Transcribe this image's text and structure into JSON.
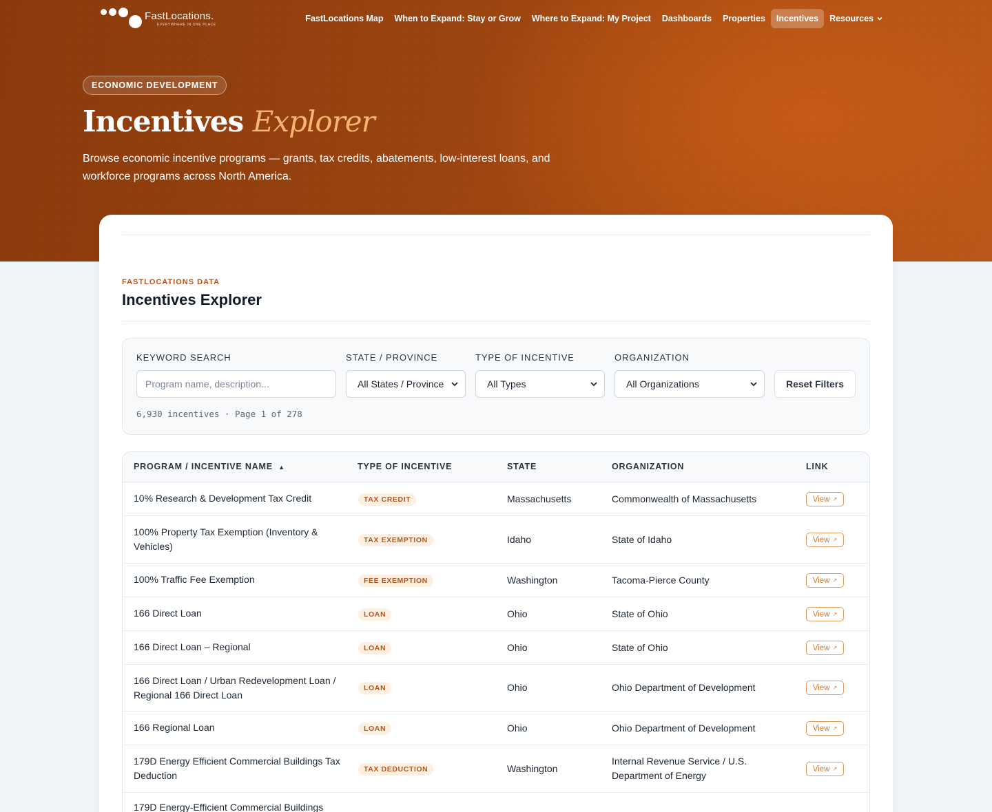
{
  "brand": {
    "name": "FastLocations.",
    "tagline": "EVERYWHERE IN ONE PLACE"
  },
  "nav": {
    "items": [
      {
        "label": "FastLocations Map",
        "active": false
      },
      {
        "label": "When to Expand: Stay or Grow",
        "active": false
      },
      {
        "label": "Where to Expand: My Project",
        "active": false
      },
      {
        "label": "Dashboards",
        "active": false
      },
      {
        "label": "Properties",
        "active": false
      },
      {
        "label": "Incentives",
        "active": true
      },
      {
        "label": "Resources",
        "active": false,
        "dropdown": true
      }
    ]
  },
  "hero": {
    "badge": "ECONOMIC DEVELOPMENT",
    "title_main": "Incentives",
    "title_accent": "Explorer",
    "description": "Browse economic incentive programs — grants, tax credits, abatements, low-interest loans, and workforce programs across North America."
  },
  "section": {
    "eyebrow": "FASTLOCATIONS DATA",
    "title": "Incentives Explorer"
  },
  "filters": {
    "keyword_label": "KEYWORD SEARCH",
    "keyword_placeholder": "Program name, description...",
    "state_label": "STATE / PROVINCE",
    "state_value": "All States / Province",
    "type_label": "TYPE OF INCENTIVE",
    "type_value": "All Types",
    "org_label": "ORGANIZATION",
    "org_value": "All Organizations",
    "reset_label": "Reset Filters",
    "summary": "6,930 incentives · Page 1 of 278"
  },
  "table": {
    "columns": [
      "PROGRAM / INCENTIVE NAME",
      "TYPE OF INCENTIVE",
      "STATE",
      "ORGANIZATION",
      "LINK"
    ],
    "sort_indicator": "▲",
    "link_label": "View",
    "rows": [
      {
        "name": "10% Research & Development Tax Credit",
        "type": "TAX CREDIT",
        "state": "Massachusetts",
        "org": "Commonwealth of Massachusetts"
      },
      {
        "name": "100% Property Tax Exemption (Inventory & Vehicles)",
        "type": "TAX EXEMPTION",
        "state": "Idaho",
        "org": "State of Idaho"
      },
      {
        "name": "100% Traffic Fee Exemption",
        "type": "FEE EXEMPTION",
        "state": "Washington",
        "org": "Tacoma-Pierce County"
      },
      {
        "name": "166 Direct Loan",
        "type": "LOAN",
        "state": "Ohio",
        "org": "State of Ohio"
      },
      {
        "name": "166 Direct Loan – Regional",
        "type": "LOAN",
        "state": "Ohio",
        "org": "State of Ohio"
      },
      {
        "name": "166 Direct Loan / Urban Redevelopment Loan / Regional 166 Direct Loan",
        "type": "LOAN",
        "state": "Ohio",
        "org": "Ohio Department of Development"
      },
      {
        "name": "166 Regional Loan",
        "type": "LOAN",
        "state": "Ohio",
        "org": "Ohio Department of Development"
      },
      {
        "name": "179D Energy Efficient Commercial Buildings Tax Deduction",
        "type": "TAX DEDUCTION",
        "state": "Washington",
        "org": "Internal Revenue Service / U.S. Department of Energy"
      },
      {
        "name": "179D Energy-Efficient Commercial Buildings",
        "type": "",
        "state": "",
        "org": ""
      }
    ]
  }
}
